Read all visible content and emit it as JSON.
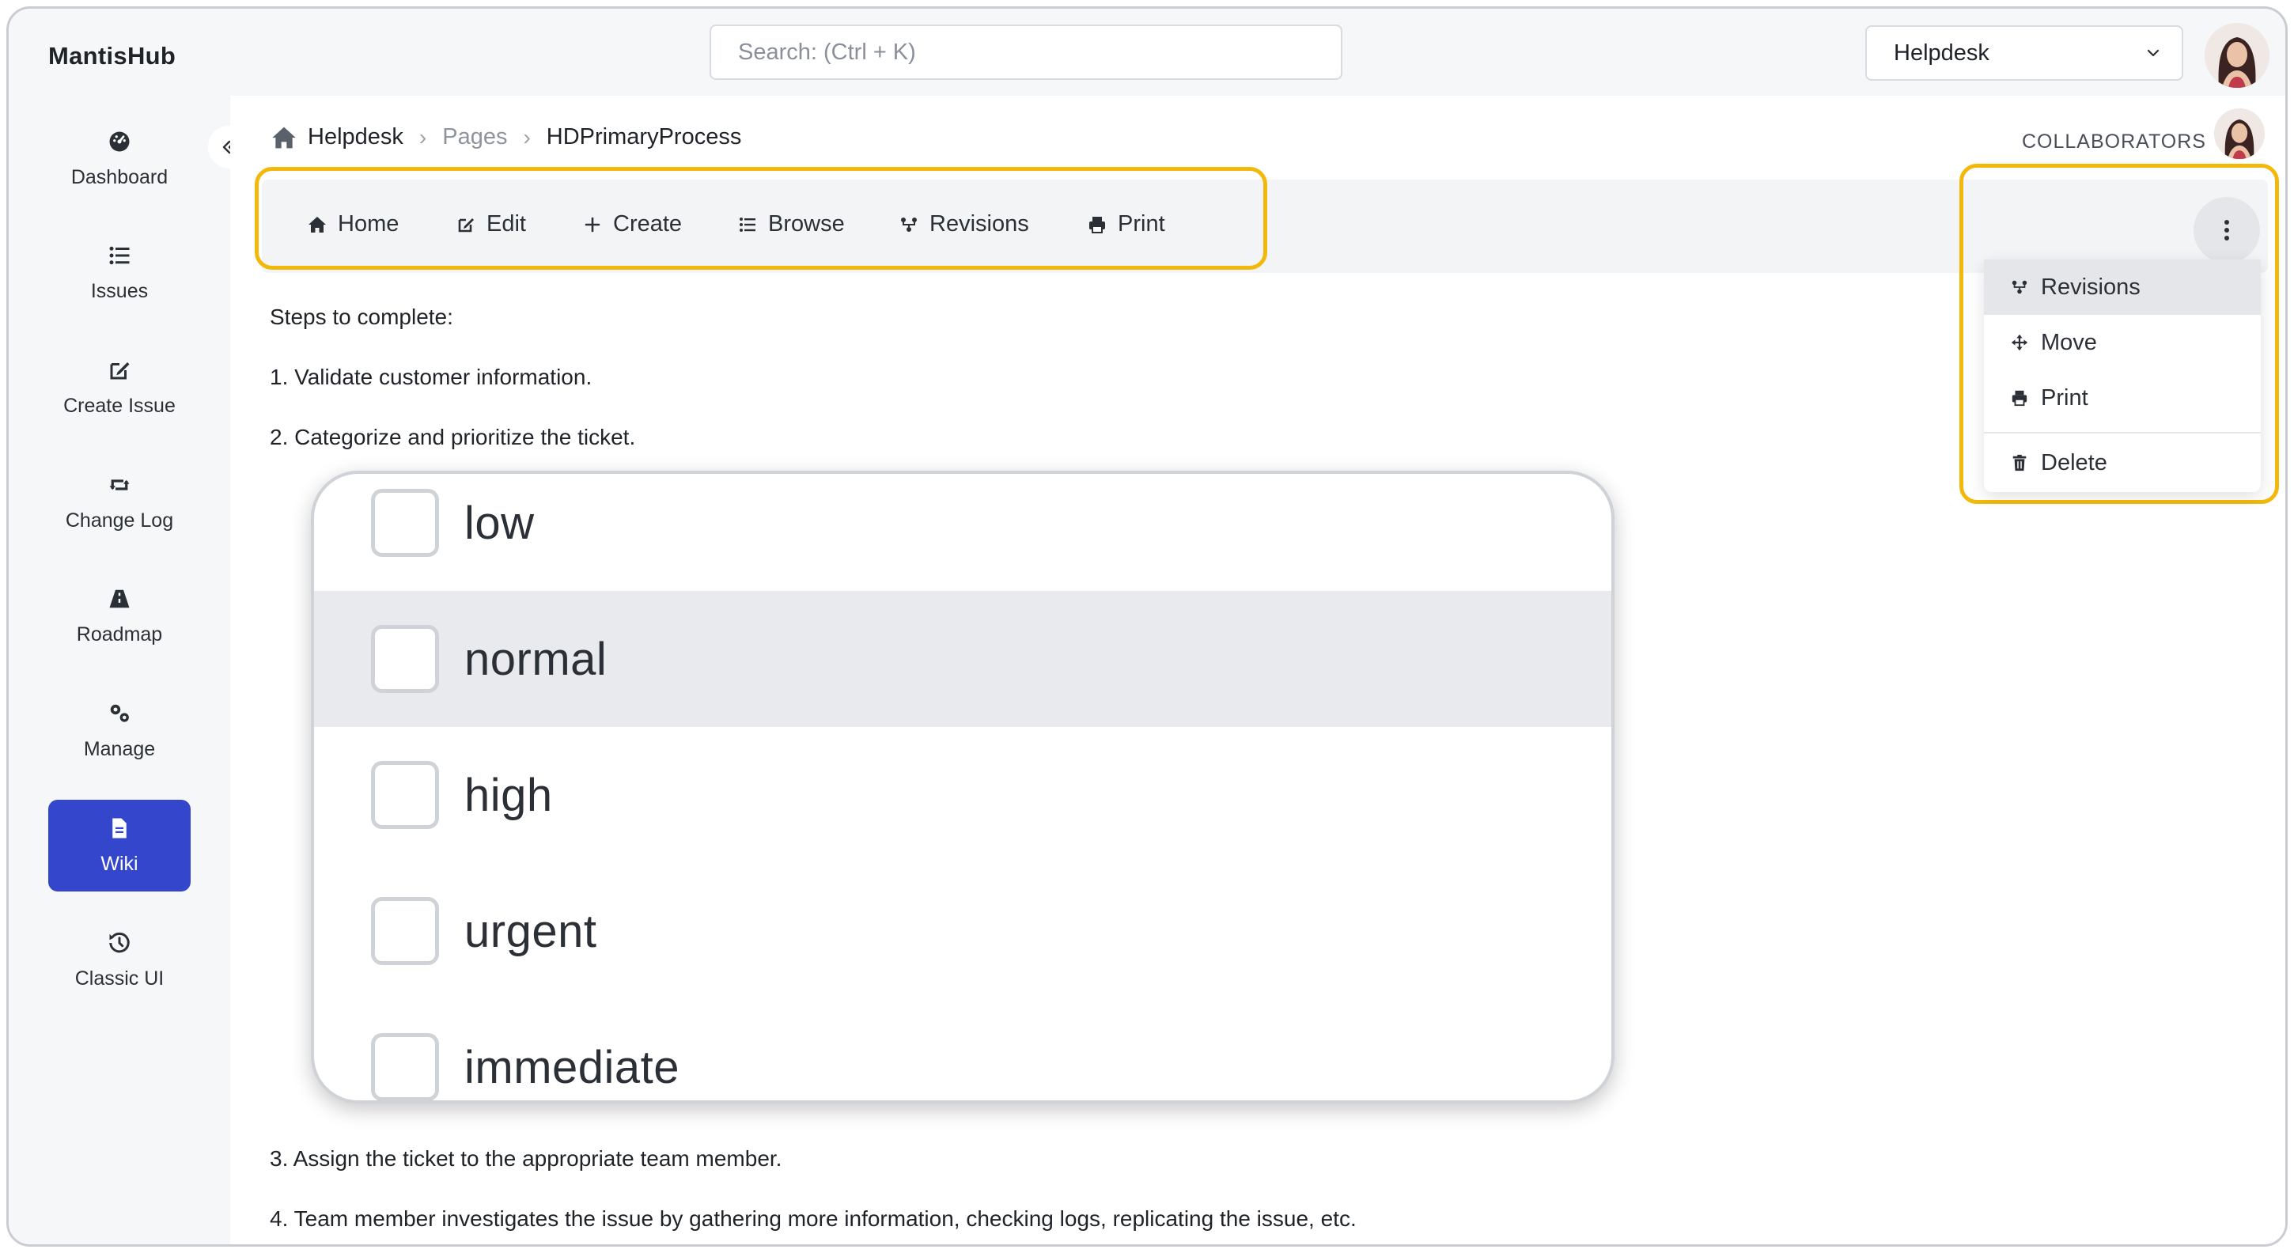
{
  "app": {
    "brand": "MantisHub"
  },
  "search": {
    "placeholder": "Search: (Ctrl + K)"
  },
  "project_selector": {
    "value": "Helpdesk"
  },
  "sidebar": {
    "items": [
      {
        "label": "Dashboard",
        "icon": "dashboard-icon"
      },
      {
        "label": "Issues",
        "icon": "list-icon"
      },
      {
        "label": "Create Issue",
        "icon": "edit-icon"
      },
      {
        "label": "Change Log",
        "icon": "retweet-icon"
      },
      {
        "label": "Roadmap",
        "icon": "road-icon"
      },
      {
        "label": "Manage",
        "icon": "gears-icon"
      },
      {
        "label": "Wiki",
        "icon": "file-icon",
        "active": true
      },
      {
        "label": "Classic UI",
        "icon": "history-icon"
      }
    ]
  },
  "breadcrumb": {
    "root": "Helpdesk",
    "middle": "Pages",
    "current": "HDPrimaryProcess"
  },
  "collaborators": {
    "label": "COLLABORATORS"
  },
  "toolbar": {
    "items": [
      {
        "label": "Home",
        "icon": "home-icon"
      },
      {
        "label": "Edit",
        "icon": "edit-icon"
      },
      {
        "label": "Create",
        "icon": "plus-icon"
      },
      {
        "label": "Browse",
        "icon": "list-icon"
      },
      {
        "label": "Revisions",
        "icon": "revisions-icon"
      },
      {
        "label": "Print",
        "icon": "print-icon"
      }
    ]
  },
  "more_menu": {
    "items": [
      {
        "label": "Revisions",
        "icon": "revisions-icon",
        "active": true
      },
      {
        "label": "Move",
        "icon": "move-icon"
      },
      {
        "label": "Print",
        "icon": "print-icon"
      },
      {
        "label": "Delete",
        "icon": "trash-icon"
      }
    ]
  },
  "content": {
    "intro": "Steps to complete:",
    "step1": "1. Validate customer information.",
    "step2": "2. Categorize and prioritize the ticket.",
    "step3": "3. Assign the ticket to the appropriate team member.",
    "step4": "4. Team member investigates the issue by gathering more information, checking logs, replicating the issue, etc."
  },
  "priority_options": [
    {
      "label": "low",
      "checked": false
    },
    {
      "label": "normal",
      "checked": false,
      "highlighted": true
    },
    {
      "label": "high",
      "checked": false
    },
    {
      "label": "urgent",
      "checked": false
    },
    {
      "label": "immediate",
      "checked": false
    }
  ],
  "colors": {
    "accent": "#3446cc",
    "highlight": "#f2b90c"
  }
}
